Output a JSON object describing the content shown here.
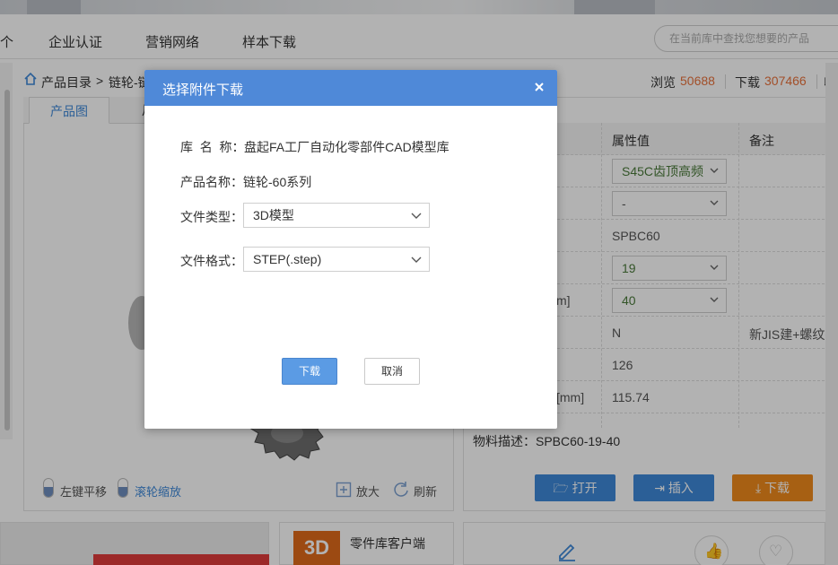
{
  "nav": {
    "items": [
      "个",
      "企业认证",
      "营销网络",
      "样本下载"
    ],
    "search_placeholder": "在当前库中查找您想要的产品"
  },
  "breadcrumb": {
    "root": "产品目录",
    "sep": ">",
    "current": "链轮-链"
  },
  "stats": {
    "views_label": "浏览",
    "views": "50688",
    "downloads_label": "下载",
    "downloads": "307466",
    "extra": "收"
  },
  "viewer": {
    "tabs": [
      "产品图",
      "尺"
    ],
    "tools": {
      "pan": "左键平移",
      "zoom_wheel": "滚轮缩放",
      "zoom_in": "放大",
      "refresh": "刷新"
    }
  },
  "props": {
    "headers": {
      "value": "属性值",
      "note": "备注"
    },
    "rows": [
      {
        "left": "",
        "value": "S45C齿顶高频",
        "type": "select",
        "note": ""
      },
      {
        "left": "",
        "value": "-",
        "type": "select",
        "note": ""
      },
      {
        "left": "",
        "value": "SPBC60",
        "type": "text",
        "note": ""
      },
      {
        "left": "",
        "value": "19",
        "type": "select",
        "note": ""
      },
      {
        "left": "m]",
        "value": "40",
        "type": "select",
        "note": ""
      },
      {
        "left": "",
        "value": "N",
        "type": "text",
        "note": "新JIS建+螺纹孔"
      },
      {
        "left": "",
        "value": "126",
        "type": "text",
        "note": ""
      },
      {
        "left": "[mm]",
        "value": "115.74",
        "type": "text",
        "note": ""
      }
    ],
    "material_desc": "物料描述：SPBC60-19-40",
    "actions": {
      "open": "打开",
      "insert": "插入",
      "download": "下载"
    }
  },
  "bottom": {
    "client_label": "零件库客户端",
    "badge": "3D"
  },
  "modal": {
    "title": "选择附件下载",
    "library_label": "库  名  称：",
    "library_value": "盘起FA工厂自动化零部件CAD模型库",
    "product_label": "产品名称：",
    "product_value": "链轮-60系列",
    "file_type_label": "文件类型：",
    "file_type_value": "3D模型",
    "file_format_label": "文件格式：",
    "file_format_value": "STEP(.step)",
    "download_button": "下载",
    "cancel_button": "取消"
  },
  "colors": {
    "header_blue": "#4f89d8",
    "primary_button": "#5b9be4",
    "accent_orange": "#e8713b",
    "action_blue": "#3e88d8",
    "action_orange": "#f08a1c"
  },
  "icons": [
    "home-icon",
    "close-icon",
    "chevron-down-icon",
    "mouse-icon",
    "zoom-icon",
    "refresh-icon",
    "folder-icon",
    "insert-icon",
    "download-icon",
    "pencil-icon",
    "thumbs-up-icon",
    "heart-icon"
  ]
}
